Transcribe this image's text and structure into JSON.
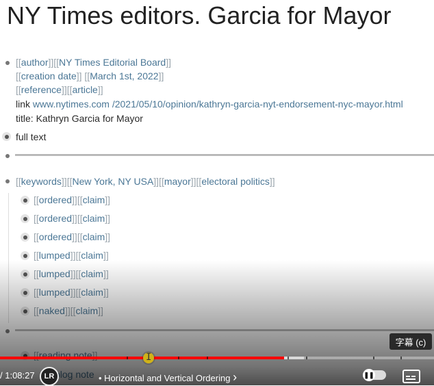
{
  "title": "NY Times editors. Garcia for Mayor",
  "meta": {
    "author": {
      "prop": "author",
      "value": "NY Times Editorial Board"
    },
    "creation_date": {
      "prop": "creation date",
      "value": "March 1st, 2022"
    },
    "reference": {
      "prop": "reference",
      "value": "article"
    },
    "link_label": "link",
    "link_url": "www.nytimes.com /2021/05/10/opinion/kathryn-garcia-nyt-endorsement-nyc-mayor.html",
    "title_line": "title: Kathryn Garcia for Mayor"
  },
  "full_text": "full text",
  "keywords": {
    "prop": "keywords",
    "items": [
      "New York, NY USA",
      "mayor",
      "electoral politics"
    ]
  },
  "claims": [
    {
      "kind": "ordered",
      "tag": "claim"
    },
    {
      "kind": "ordered",
      "tag": "claim"
    },
    {
      "kind": "ordered",
      "tag": "claim"
    },
    {
      "kind": "lumped",
      "tag": "claim"
    },
    {
      "kind": "lumped",
      "tag": "claim"
    },
    {
      "kind": "lumped",
      "tag": "claim"
    },
    {
      "kind": "naked",
      "tag": "claim"
    }
  ],
  "reading_note": "reading note",
  "blog_note": "blog note",
  "player": {
    "tooltip": "字幕 (c)",
    "time": "/ 1:08:27",
    "avatar": "LR",
    "chapter": "• Horizontal and Vertical Ordering",
    "chapter_arrow": "›",
    "progress_played": 0.655,
    "progress_buffered": 0.7,
    "accent": "#ff0000"
  }
}
